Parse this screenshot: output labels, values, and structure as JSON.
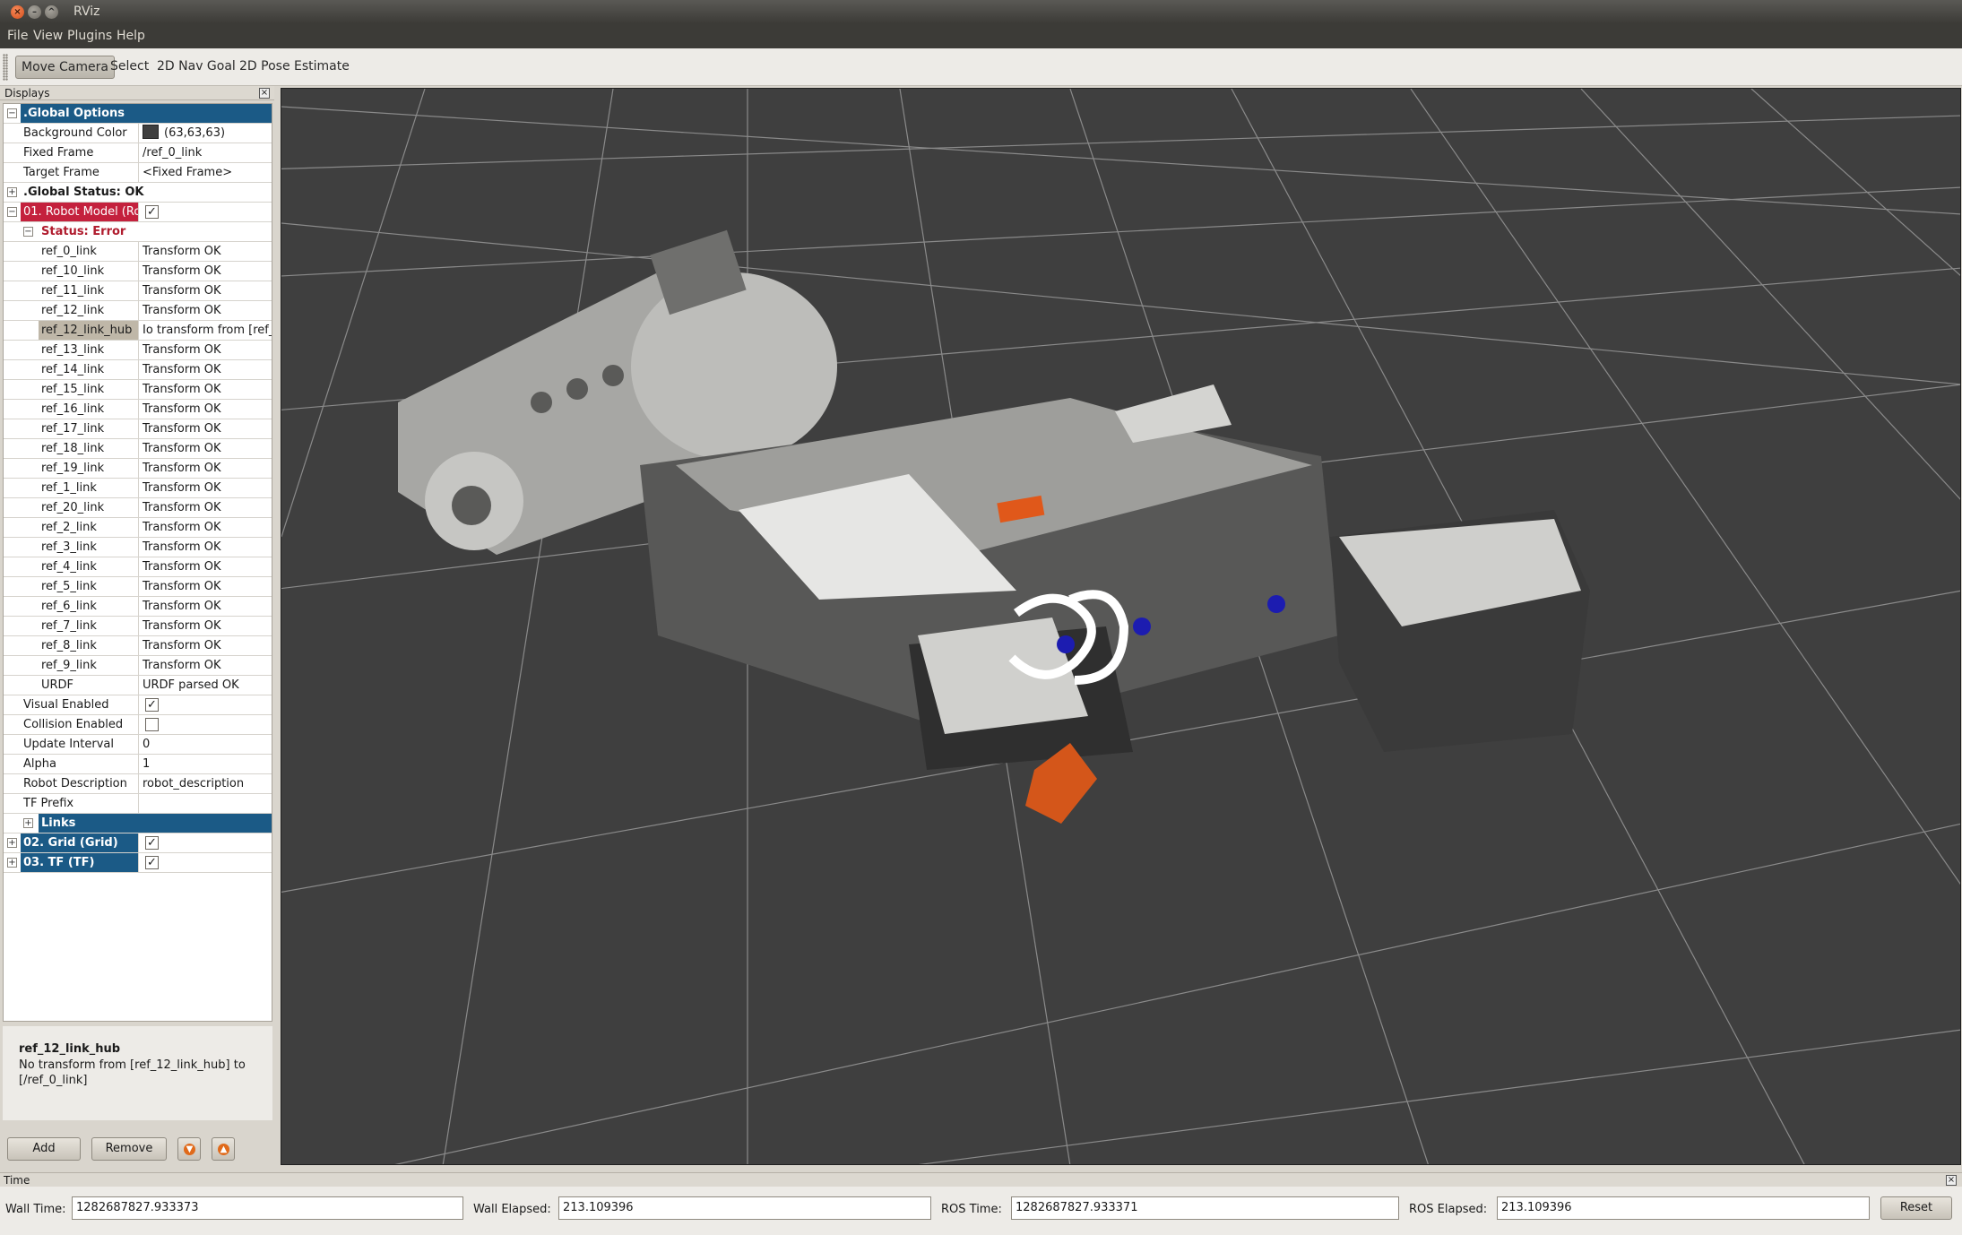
{
  "window": {
    "title": "RViz"
  },
  "menu": [
    "File",
    "View",
    "Plugins",
    "Help"
  ],
  "toolbar": {
    "tools": [
      "Move Camera",
      "Select",
      "2D Nav Goal",
      "2D Pose Estimate"
    ],
    "active": "Move Camera"
  },
  "displays": {
    "header": "Displays",
    "rows": [
      {
        "label": ".Global Options",
        "value": "",
        "kind": "header-blue",
        "expander": "minus"
      },
      {
        "label": "Background Color",
        "value": "(63,63,63)",
        "kind": "prop",
        "swatch": "#3f3f3f"
      },
      {
        "label": "Fixed Frame",
        "value": "/ref_0_link",
        "kind": "prop"
      },
      {
        "label": "Target Frame",
        "value": "<Fixed Frame>",
        "kind": "prop"
      },
      {
        "label": ".Global Status: OK",
        "value": "",
        "kind": "header-bold",
        "expander": "plus"
      },
      {
        "label": "01. Robot Model (Ro",
        "value": "",
        "kind": "header-red",
        "expander": "minus",
        "checked": true
      },
      {
        "label": "Status: Error",
        "value": "",
        "kind": "status-error",
        "expander": "minus"
      },
      {
        "label": "ref_0_link",
        "value": "Transform OK",
        "kind": "link"
      },
      {
        "label": "ref_10_link",
        "value": "Transform OK",
        "kind": "link"
      },
      {
        "label": "ref_11_link",
        "value": "Transform OK",
        "kind": "link"
      },
      {
        "label": "ref_12_link",
        "value": "Transform OK",
        "kind": "link"
      },
      {
        "label": "ref_12_link_hub",
        "value": "Io transform from [ref_",
        "kind": "link-selected"
      },
      {
        "label": "ref_13_link",
        "value": "Transform OK",
        "kind": "link"
      },
      {
        "label": "ref_14_link",
        "value": "Transform OK",
        "kind": "link"
      },
      {
        "label": "ref_15_link",
        "value": "Transform OK",
        "kind": "link"
      },
      {
        "label": "ref_16_link",
        "value": "Transform OK",
        "kind": "link"
      },
      {
        "label": "ref_17_link",
        "value": "Transform OK",
        "kind": "link"
      },
      {
        "label": "ref_18_link",
        "value": "Transform OK",
        "kind": "link"
      },
      {
        "label": "ref_19_link",
        "value": "Transform OK",
        "kind": "link"
      },
      {
        "label": "ref_1_link",
        "value": "Transform OK",
        "kind": "link"
      },
      {
        "label": "ref_20_link",
        "value": "Transform OK",
        "kind": "link"
      },
      {
        "label": "ref_2_link",
        "value": "Transform OK",
        "kind": "link"
      },
      {
        "label": "ref_3_link",
        "value": "Transform OK",
        "kind": "link"
      },
      {
        "label": "ref_4_link",
        "value": "Transform OK",
        "kind": "link"
      },
      {
        "label": "ref_5_link",
        "value": "Transform OK",
        "kind": "link"
      },
      {
        "label": "ref_6_link",
        "value": "Transform OK",
        "kind": "link"
      },
      {
        "label": "ref_7_link",
        "value": "Transform OK",
        "kind": "link"
      },
      {
        "label": "ref_8_link",
        "value": "Transform OK",
        "kind": "link"
      },
      {
        "label": "ref_9_link",
        "value": "Transform OK",
        "kind": "link"
      },
      {
        "label": "URDF",
        "value": "URDF parsed OK",
        "kind": "link"
      },
      {
        "label": "Visual Enabled",
        "value": "",
        "kind": "check",
        "checked": true
      },
      {
        "label": "Collision Enabled",
        "value": "",
        "kind": "check",
        "checked": false
      },
      {
        "label": "Update Interval",
        "value": "0",
        "kind": "prop2"
      },
      {
        "label": "Alpha",
        "value": "1",
        "kind": "prop2"
      },
      {
        "label": "Robot Description",
        "value": "robot_description",
        "kind": "prop2"
      },
      {
        "label": "TF Prefix",
        "value": "",
        "kind": "prop2"
      },
      {
        "label": "Links",
        "value": "",
        "kind": "header-blue-sub",
        "expander": "plus"
      },
      {
        "label": "02. Grid (Grid)",
        "value": "",
        "kind": "header-blue-check",
        "expander": "plus",
        "checked": true
      },
      {
        "label": "03. TF (TF)",
        "value": "",
        "kind": "header-blue-check",
        "expander": "plus",
        "checked": true
      }
    ]
  },
  "description": {
    "name": "ref_12_link_hub",
    "text": "No transform from [ref_12_link_hub] to [/ref_0_link]"
  },
  "panel_buttons": {
    "add": "Add",
    "remove": "Remove"
  },
  "time": {
    "header": "Time",
    "wall_time_label": "Wall Time:",
    "wall_time": "1282687827.933373",
    "wall_elapsed_label": "Wall Elapsed:",
    "wall_elapsed": "213.109396",
    "ros_time_label": "ROS Time:",
    "ros_time": "1282687827.933371",
    "ros_elapsed_label": "ROS Elapsed:",
    "ros_elapsed": "213.109396",
    "reset": "Reset"
  },
  "colors": {
    "viewport_bg": "#3f3f3f",
    "accent_blue": "#1b5a86",
    "error_red": "#c4213d",
    "marker_orange": "#e0581a"
  }
}
